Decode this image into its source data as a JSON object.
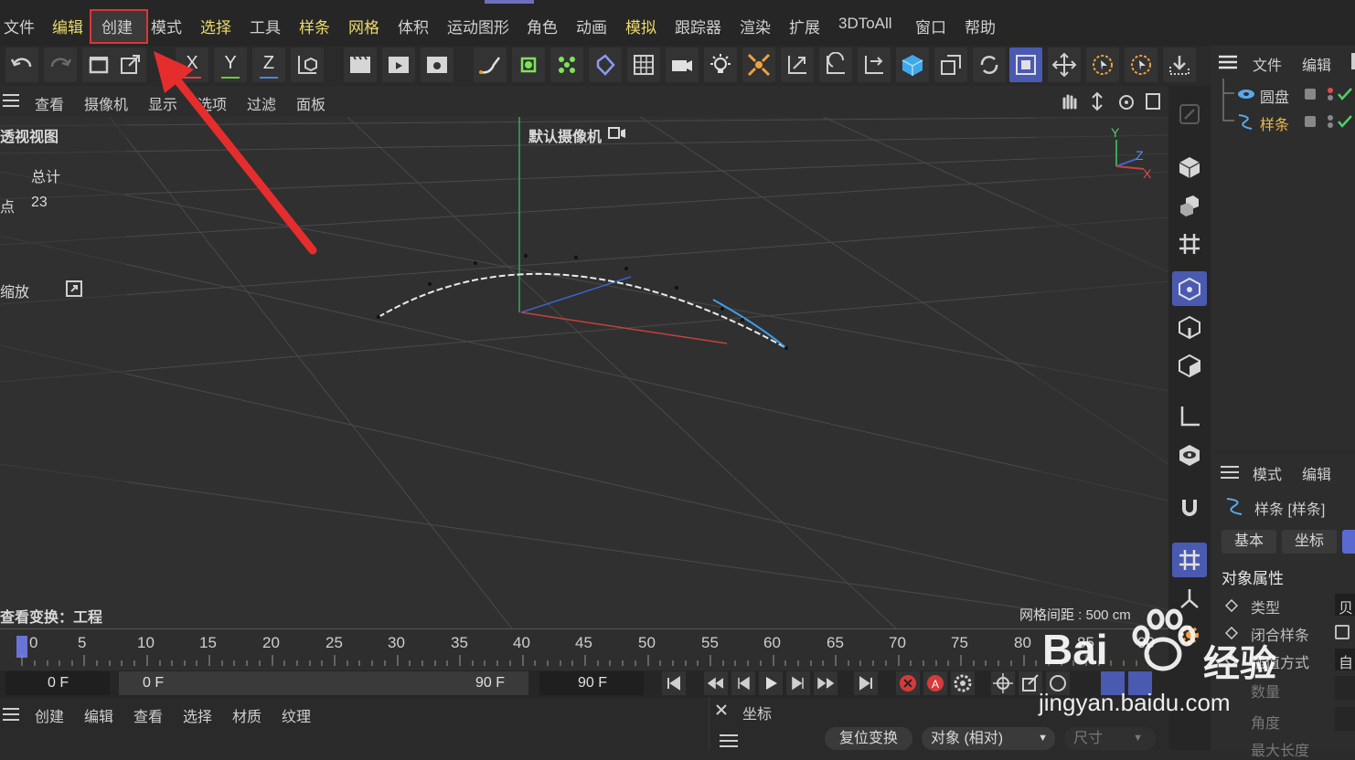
{
  "menu": {
    "items": [
      {
        "label": "文件",
        "highlight": false
      },
      {
        "label": "编辑",
        "highlight": true
      },
      {
        "label": "创建",
        "highlight": false
      },
      {
        "label": "模式",
        "highlight": false
      },
      {
        "label": "选择",
        "highlight": true
      },
      {
        "label": "工具",
        "highlight": false
      },
      {
        "label": "样条",
        "highlight": true
      },
      {
        "label": "网格",
        "highlight": true
      },
      {
        "label": "体积",
        "highlight": false
      },
      {
        "label": "运动图形",
        "highlight": false
      },
      {
        "label": "角色",
        "highlight": false
      },
      {
        "label": "动画",
        "highlight": false
      },
      {
        "label": "模拟",
        "highlight": true
      },
      {
        "label": "跟踪器",
        "highlight": false
      },
      {
        "label": "渲染",
        "highlight": false
      },
      {
        "label": "扩展",
        "highlight": false
      },
      {
        "label": "3DToAll",
        "highlight": false
      },
      {
        "label": "窗口",
        "highlight": false
      },
      {
        "label": "帮助",
        "highlight": false
      }
    ],
    "annotated_item": "创建"
  },
  "toolbar": {
    "axis_x": "X",
    "axis_y": "Y",
    "axis_z": "Z",
    "icons": [
      "undo-icon",
      "redo-icon",
      "object-mode-icon",
      "external-icon",
      "axis-x-icon",
      "axis-y-icon",
      "axis-z-icon",
      "coordinate-system-icon",
      "render-view-icon",
      "render-icon",
      "render-settings-icon",
      "spline-pen-icon",
      "object-icon",
      "cloner-icon",
      "deformer-icon",
      "grid-icon",
      "camera-icon",
      "light-icon",
      "explode-icon",
      "scale-icon",
      "rotate-icon",
      "move-icon",
      "cube-icon",
      "scale-tool-icon",
      "rotate-tool-icon",
      "select-tool-icon",
      "move-tool-icon",
      "live-select-icon",
      "loop-select-icon",
      "download-icon"
    ]
  },
  "view_menu": {
    "items": [
      "查看",
      "摄像机",
      "显示",
      "选项",
      "过滤",
      "面板"
    ]
  },
  "viewport": {
    "title": "透视视图",
    "camera_label": "默认摄像机",
    "stats_header": "总计",
    "stats_points_label": "点",
    "stats_points_value": "23",
    "zoom_label": "缩放",
    "view_transform": "查看变换：工程",
    "grid_spacing": "网格间距 : 500 cm",
    "axis_gizmo": {
      "y": "Y",
      "z": "Z",
      "x": "X"
    }
  },
  "object_manager": {
    "menu": [
      "文件",
      "编辑"
    ],
    "objects": [
      {
        "name": "圆盘",
        "selected": false
      },
      {
        "name": "样条",
        "selected": true
      }
    ]
  },
  "attribute_manager": {
    "menu": [
      "模式",
      "编辑"
    ],
    "object_title": "样条 [样条]",
    "tabs": [
      "基本",
      "坐标"
    ],
    "section_title": "对象属性",
    "fields": [
      "类型",
      "闭合样条",
      "插值方式",
      "数量",
      "角度",
      "最大长度"
    ],
    "field_values": [
      "贝",
      "",
      "自"
    ]
  },
  "timeline": {
    "ticks": [
      "0",
      "5",
      "10",
      "15",
      "20",
      "25",
      "30",
      "35",
      "40",
      "45",
      "50",
      "55",
      "60",
      "65",
      "70",
      "75",
      "80",
      "85",
      "90"
    ],
    "current_frame": "0",
    "start_field": "0 F",
    "range_start": "0 F",
    "range_end": "90 F",
    "end_field": "90 F"
  },
  "bottom_menu": {
    "items": [
      "创建",
      "编辑",
      "查看",
      "选择",
      "材质",
      "纹理"
    ]
  },
  "coord_panel": {
    "title": "坐标",
    "reset_button": "复位变换",
    "mode_select": "对象 (相对)",
    "size_select": "尺寸"
  },
  "watermark": {
    "text1": "Bai",
    "text2": "经验",
    "url": "jingyan.baidu.com"
  },
  "colors": {
    "accent": "#4a5ab0",
    "menu_highlight": "#ecd96a",
    "annotation_red": "#e03434",
    "spline": "#e6e6e6",
    "spline_end": "#3d9ee8"
  }
}
